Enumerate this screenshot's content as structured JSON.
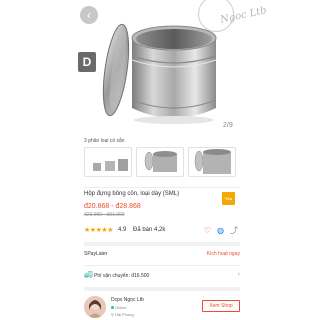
{
  "header": {
    "back_icon": "chevron-left",
    "video_icon": "play",
    "watermark_text": "Ngoc Ltb",
    "image_counter": "2/9"
  },
  "variants": {
    "label": "3 phân loại có sẵn",
    "thumbs": [
      "small-canister",
      "medium-canister",
      "large-canister"
    ]
  },
  "product": {
    "title": "Hộp đựng bông cồn, loại dày (SML)",
    "price_range": "đ20.868 - đ28.868",
    "original_price_range": "đ23.900 - đ31.900",
    "badge": "Yêu thích",
    "rating": "4.9",
    "rating_stars": 5,
    "sold": "Đã bán 4,2k",
    "colors": {
      "accent": "#ee4d2d",
      "star": "#f6a700"
    }
  },
  "spaylater": {
    "label": "SPayLater",
    "link": "Kích hoạt ngay"
  },
  "shipping": {
    "label": "Phí vận chuyển: đ16.500"
  },
  "shop": {
    "name": "Dcpx Ngọc Ltb",
    "status": "Online",
    "location": "Hải Phòng",
    "view_button": "Xem Shop"
  }
}
